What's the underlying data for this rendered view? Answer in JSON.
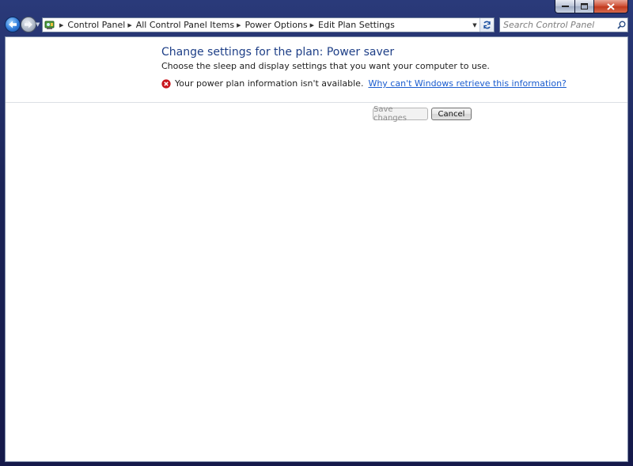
{
  "window": {
    "caption_buttons": {
      "minimize": "minimize-icon",
      "maximize": "maximize-icon",
      "close": "close-icon"
    }
  },
  "navigation": {
    "back_icon": "back-arrow-icon",
    "forward_icon": "forward-arrow-icon"
  },
  "address_bar": {
    "icon": "control-panel-icon",
    "breadcrumbs": [
      "Control Panel",
      "All Control Panel Items",
      "Power Options",
      "Edit Plan Settings"
    ]
  },
  "search": {
    "placeholder": "Search Control Panel"
  },
  "main": {
    "title": "Change settings for the plan: Power saver",
    "description": "Choose the sleep and display settings that you want your computer to use.",
    "error_message": "Your power plan information isn't available.",
    "help_link": "Why can't Windows retrieve this information?"
  },
  "buttons": {
    "save_label": "Save changes",
    "save_enabled": false,
    "cancel_label": "Cancel"
  },
  "colors": {
    "title": "#1e3f87",
    "link": "#1a5ccf",
    "error": "#c8161d",
    "frame": "#1b2457"
  }
}
